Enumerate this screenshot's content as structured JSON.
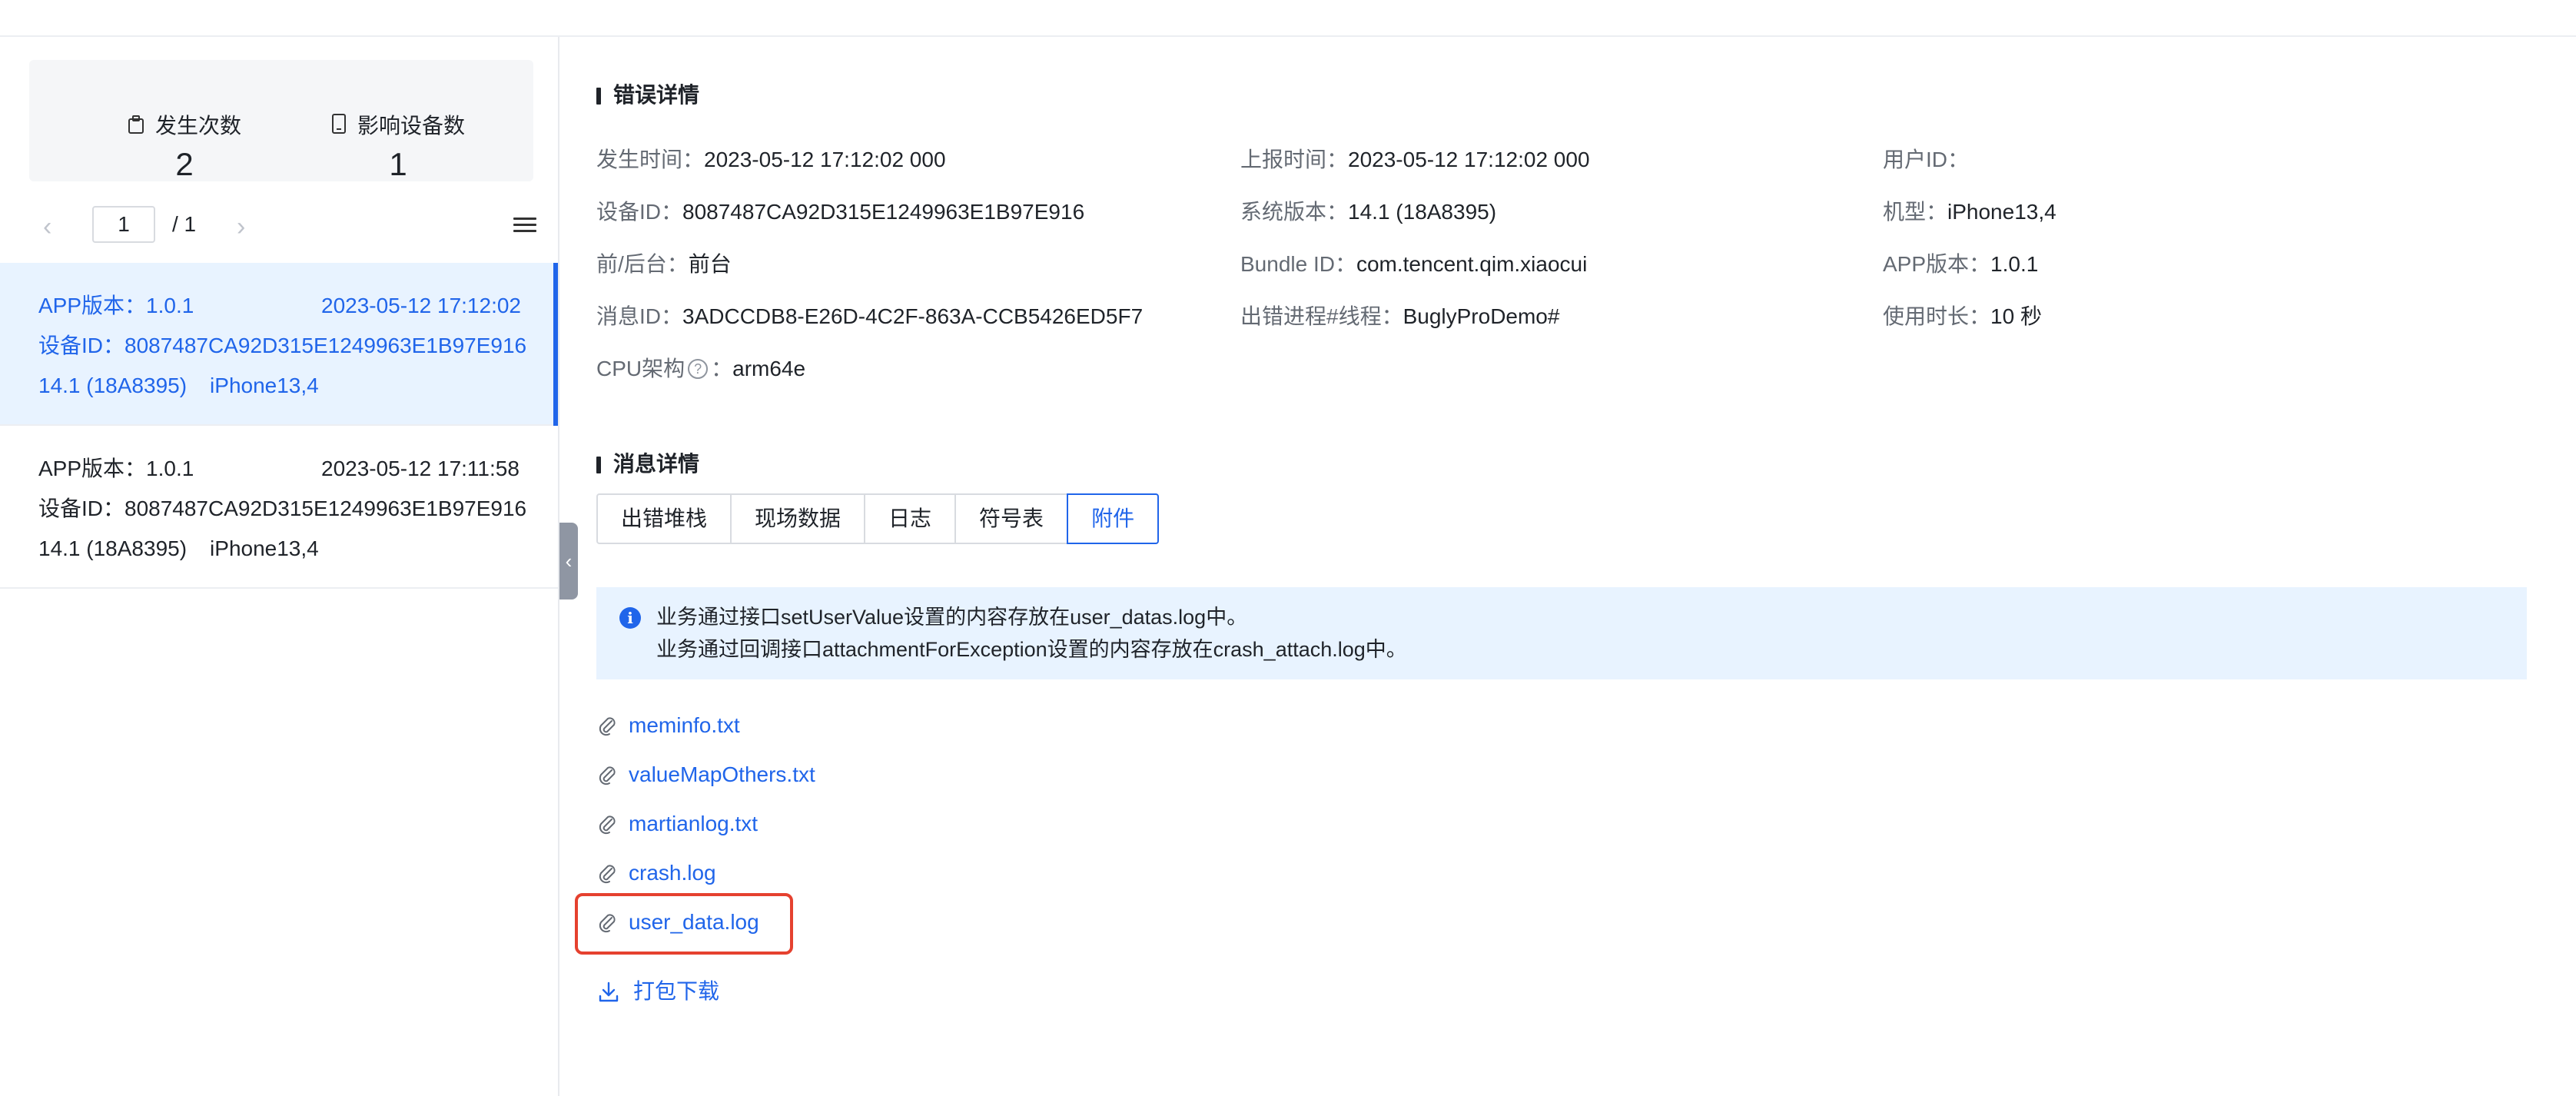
{
  "stats": [
    {
      "label": "发生次数",
      "value": "2",
      "icon": "clipboard-icon"
    },
    {
      "label": "影响设备数",
      "value": "1",
      "icon": "phone-icon"
    }
  ],
  "pager": {
    "current": "1",
    "total": "/ 1"
  },
  "crash_list": [
    {
      "app_version": "APP版本：1.0.1",
      "time": "2023-05-12 17:12:02",
      "device_id": "设备ID：8087487CA92D315E1249963E1B97E916",
      "os": "14.1 (18A8395)",
      "model": "iPhone13,4",
      "selected": true
    },
    {
      "app_version": "APP版本：1.0.1",
      "time": "2023-05-12 17:11:58",
      "device_id": "设备ID：8087487CA92D315E1249963E1B97E916",
      "os": "14.1 (18A8395)",
      "model": "iPhone13,4",
      "selected": false
    }
  ],
  "error_details": {
    "title": "错误详情",
    "rows": [
      [
        {
          "key": "发生时间：",
          "value": "2023-05-12 17:12:02 000"
        },
        {
          "key": "上报时间：",
          "value": "2023-05-12 17:12:02 000"
        },
        {
          "key": "用户ID：",
          "value": ""
        }
      ],
      [
        {
          "key": "设备ID：",
          "value": "8087487CA92D315E1249963E1B97E916"
        },
        {
          "key": "系统版本：",
          "value": "14.1 (18A8395)"
        },
        {
          "key": "机型：",
          "value": "iPhone13,4"
        }
      ],
      [
        {
          "key": "前/后台：",
          "value": "前台"
        },
        {
          "key": "Bundle ID：",
          "value": "com.tencent.qim.xiaocui"
        },
        {
          "key": "APP版本：",
          "value": "1.0.1"
        }
      ],
      [
        {
          "key": "消息ID：",
          "value": "3ADCCDB8-E26D-4C2F-863A-CCB5426ED5F7"
        },
        {
          "key": "出错进程#线程：",
          "value": "BuglyProDemo#"
        },
        {
          "key": "使用时长：",
          "value": "10 秒"
        }
      ]
    ],
    "cpu": {
      "key": "CPU架构",
      "help": "?",
      "sep": "：",
      "value": "arm64e"
    }
  },
  "message_details": {
    "title": "消息详情",
    "tabs": [
      {
        "label": "出错堆栈",
        "active": false
      },
      {
        "label": "现场数据",
        "active": false
      },
      {
        "label": "日志",
        "active": false
      },
      {
        "label": "符号表",
        "active": false
      },
      {
        "label": "附件",
        "active": true
      }
    ],
    "info_icon": "i",
    "info_lines": [
      "业务通过接口setUserValue设置的内容存放在user_datas.log中。",
      "业务通过回调接口attachmentForException设置的内容存放在crash_attach.log中。"
    ],
    "attachments": [
      "meminfo.txt",
      "valueMapOthers.txt",
      "martianlog.txt",
      "crash.log",
      "user_data.log"
    ],
    "highlighted_attachment": "user_data.log",
    "download_label": "打包下载"
  },
  "colors": {
    "accent": "#2065ea",
    "highlight_border": "#e5412f",
    "selected_bg": "#e8f3ff",
    "info_bg": "#e8f3ff"
  }
}
